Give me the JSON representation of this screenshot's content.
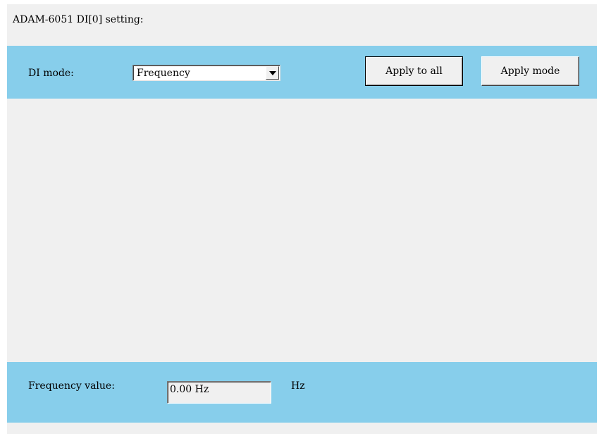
{
  "title": "ADAM-6051 DI[0] setting:",
  "mode_section": {
    "label": "DI mode:",
    "selected": "Frequency",
    "apply_all_label": "Apply to all",
    "apply_mode_label": "Apply mode"
  },
  "frequency_section": {
    "label": "Frequency value:",
    "value": "0.00 Hz",
    "unit": "Hz"
  }
}
